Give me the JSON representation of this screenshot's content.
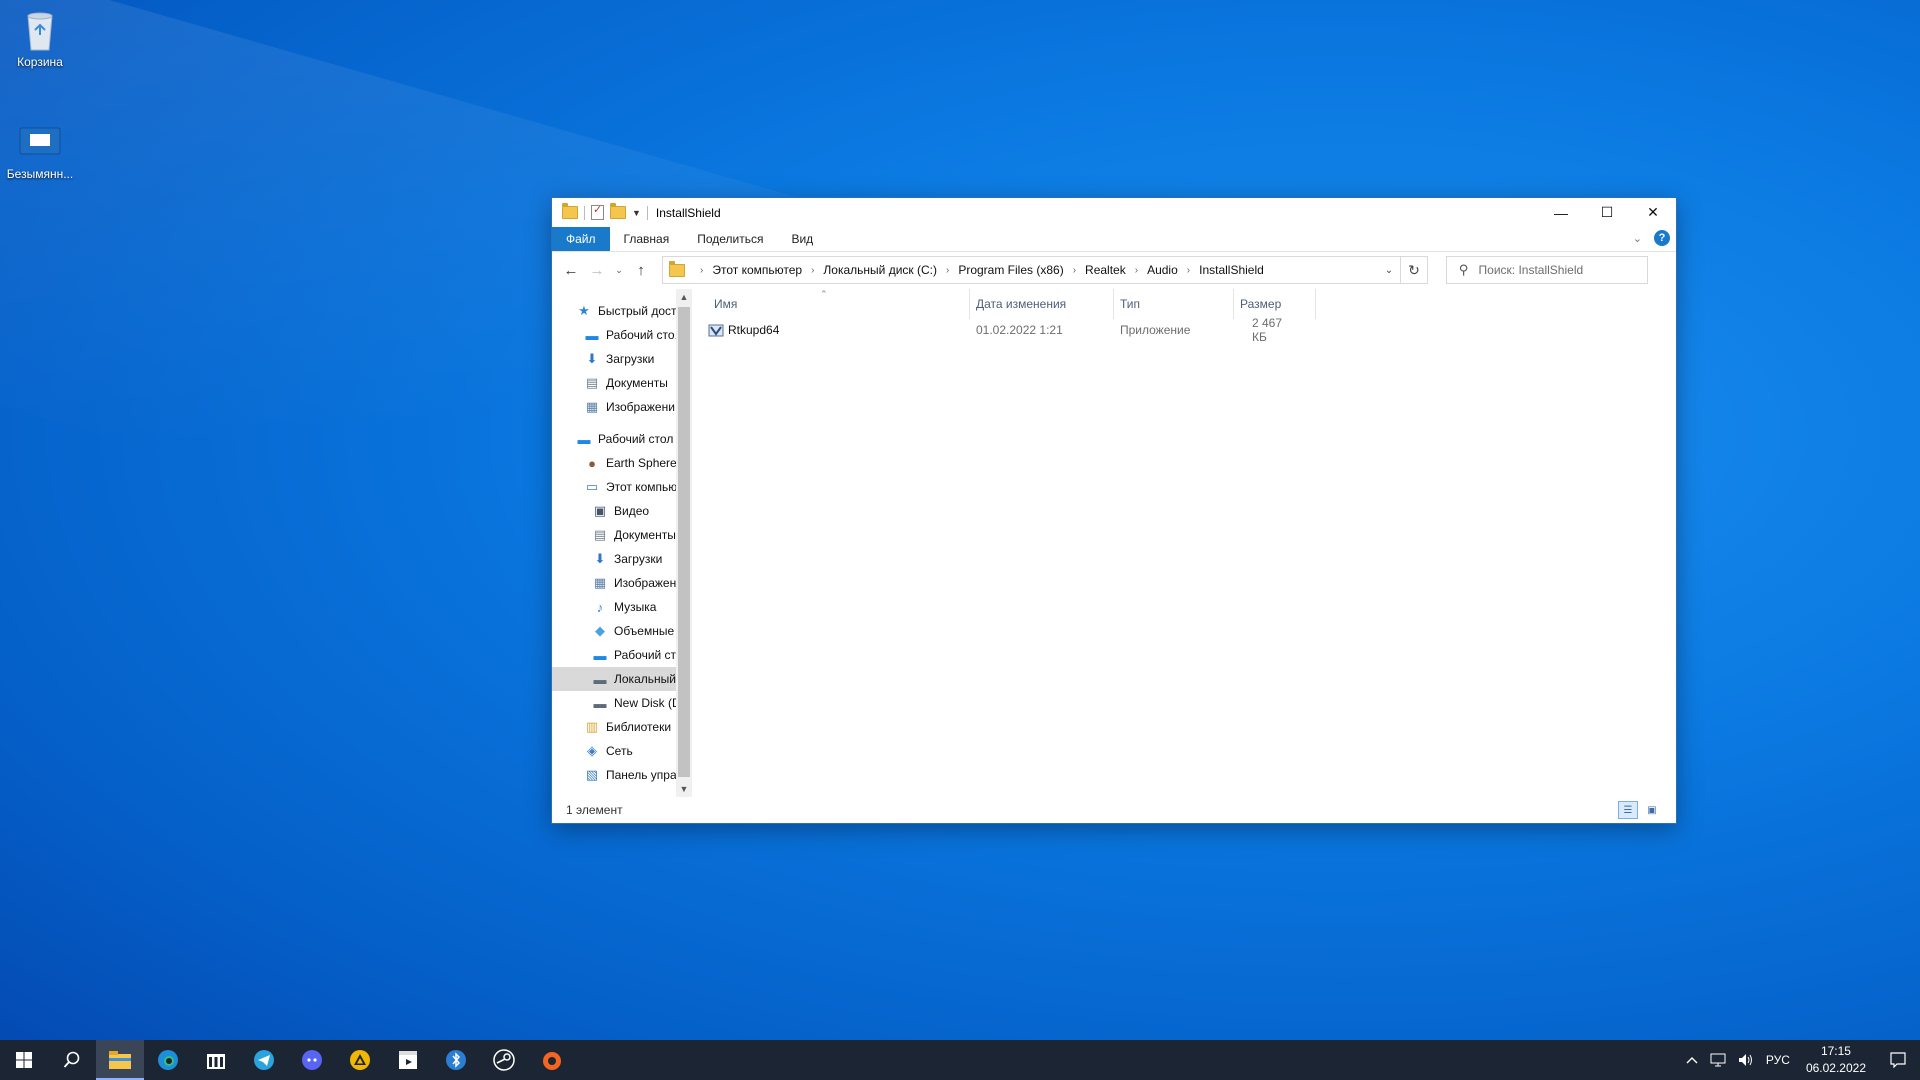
{
  "desktop": {
    "icons": [
      {
        "label": "Корзина"
      },
      {
        "label": "Безымянн..."
      }
    ]
  },
  "window": {
    "title": "InstallShield",
    "ribbon_tabs": [
      "Файл",
      "Главная",
      "Поделиться",
      "Вид"
    ],
    "help_label": "?",
    "breadcrumb": [
      "Этот компьютер",
      "Локальный диск (C:)",
      "Program Files (x86)",
      "Realtek",
      "Audio",
      "InstallShield"
    ],
    "search_placeholder": "Поиск: InstallShield",
    "nav_items": [
      {
        "label": "Быстрый доступ",
        "icon": "star-icon",
        "indent": 1,
        "pinned": false
      },
      {
        "label": "Рабочий сто.",
        "icon": "desktop-icon",
        "indent": 2,
        "pinned": true
      },
      {
        "label": "Загрузки",
        "icon": "download-icon",
        "indent": 2,
        "pinned": true
      },
      {
        "label": "Документы",
        "icon": "document-icon",
        "indent": 2,
        "pinned": true
      },
      {
        "label": "Изображени",
        "icon": "pictures-icon",
        "indent": 2,
        "pinned": true
      },
      {
        "label": "Рабочий стол",
        "icon": "desktop-icon",
        "indent": 1,
        "pinned": false
      },
      {
        "label": "Earth Sphere",
        "icon": "user-icon",
        "indent": 2,
        "pinned": false
      },
      {
        "label": "Этот компьютер",
        "icon": "computer-icon",
        "indent": 2,
        "pinned": false
      },
      {
        "label": "Видео",
        "icon": "video-icon",
        "indent": 3,
        "pinned": false
      },
      {
        "label": "Документы",
        "icon": "document-icon",
        "indent": 3,
        "pinned": false
      },
      {
        "label": "Загрузки",
        "icon": "download-icon",
        "indent": 3,
        "pinned": false
      },
      {
        "label": "Изображения",
        "icon": "pictures-icon",
        "indent": 3,
        "pinned": false
      },
      {
        "label": "Музыка",
        "icon": "music-icon",
        "indent": 3,
        "pinned": false
      },
      {
        "label": "Объемные об",
        "icon": "3d-objects-icon",
        "indent": 3,
        "pinned": false
      },
      {
        "label": "Рабочий стол",
        "icon": "desktop-icon",
        "indent": 3,
        "pinned": false
      },
      {
        "label": "Локальный ди",
        "icon": "local-disk-icon",
        "indent": 3,
        "pinned": false,
        "selected": true
      },
      {
        "label": "New Disk (D:)",
        "icon": "disk-icon",
        "indent": 3,
        "pinned": false
      },
      {
        "label": "Библиотеки",
        "icon": "library-icon",
        "indent": 2,
        "pinned": false
      },
      {
        "label": "Сеть",
        "icon": "network-icon",
        "indent": 2,
        "pinned": false
      },
      {
        "label": "Панель управле",
        "icon": "control-panel-icon",
        "indent": 2,
        "pinned": false
      }
    ],
    "columns": [
      "Имя",
      "Дата изменения",
      "Тип",
      "Размер"
    ],
    "files": [
      {
        "name": "Rtkupd64",
        "date": "01.02.2022 1:21",
        "type": "Приложение",
        "size": "2 467 КБ"
      }
    ],
    "status": "1 элемент"
  },
  "taskbar": {
    "apps": [
      "start-icon",
      "search-icon",
      "file-explorer-icon",
      "edge-icon",
      "store-icon",
      "telegram-icon",
      "discord-icon",
      "app-triangle-icon",
      "media-icon",
      "bluetooth-app-icon",
      "steam-icon",
      "origin-icon"
    ],
    "tray": {
      "lang": "РУС",
      "time": "17:15",
      "date": "06.02.2022"
    }
  }
}
